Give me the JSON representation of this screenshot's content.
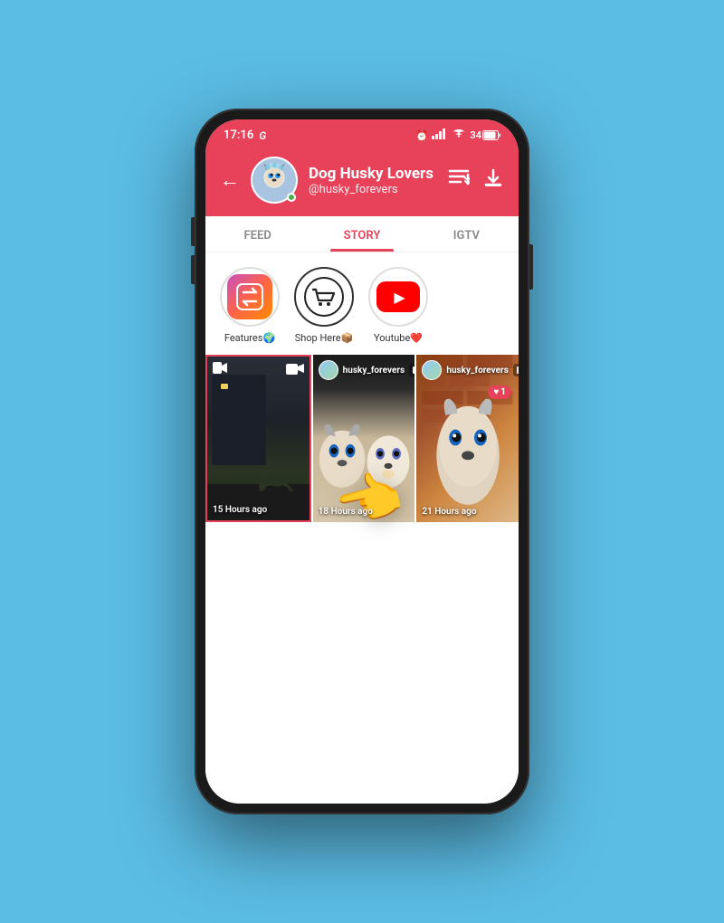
{
  "phone": {
    "status_bar": {
      "time": "17:16",
      "carrier_icon": "G",
      "alarm_icon": "⏰",
      "signal": "▂▄▆█",
      "wifi": "WiFi",
      "battery": "34"
    }
  },
  "header": {
    "back_label": "←",
    "profile_name": "Dog Husky Lovers",
    "profile_username": "@husky_forevers",
    "avatar_emoji": "🐺",
    "sort_icon": "sort",
    "download_icon": "download"
  },
  "tabs": [
    {
      "id": "feed",
      "label": "FEED",
      "active": false
    },
    {
      "id": "story",
      "label": "STORY",
      "active": true
    },
    {
      "id": "igtv",
      "label": "IGTV",
      "active": false
    }
  ],
  "highlights": [
    {
      "id": "features",
      "label": "Features🌍",
      "icon_type": "features"
    },
    {
      "id": "shop",
      "label": "Shop Here📦",
      "icon_type": "shop"
    },
    {
      "id": "youtube",
      "label": "Youtube❤️",
      "icon_type": "youtube"
    }
  ],
  "stories": [
    {
      "id": "story1",
      "timestamp": "15 Hours ago",
      "type": "video",
      "username": "",
      "has_camera_icon": true,
      "has_video_icon": true,
      "selected": true
    },
    {
      "id": "story2",
      "timestamp": "18 Hours ago",
      "username": "husky_forevers",
      "has_camera_icon": false,
      "selected": false
    },
    {
      "id": "story3",
      "timestamp": "21 Hours ago",
      "username": "husky_forevers",
      "has_camera_icon": false,
      "has_like": true,
      "like_count": "1",
      "selected": false
    }
  ],
  "icons": {
    "back": "←",
    "sort_filter": "≡↓",
    "download": "⬇",
    "video_camera": "📹",
    "story_icon": "🎬",
    "heart": "♥",
    "pointer": "👈"
  }
}
